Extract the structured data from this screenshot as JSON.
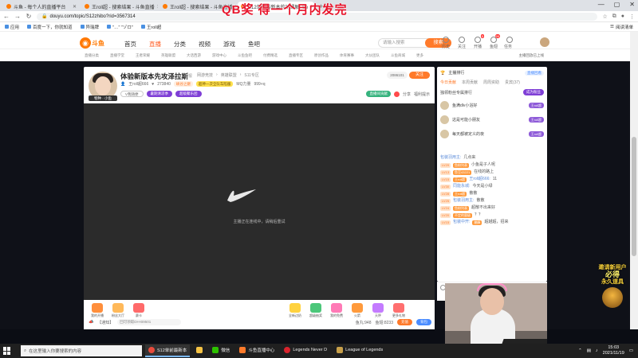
{
  "overlay_caption": "QB奖  得一个月内发完",
  "browser": {
    "tabs": [
      {
        "title": "斗鱼 - 每个人的直播平台",
        "active": false
      },
      {
        "title": "王roll超 - 搜索结果 - 斗鱼直播",
        "active": false
      },
      {
        "title": "王roll超 - 搜索结果 - 斗鱼直播",
        "active": false
      },
      {
        "title": "S12单前最新本的功课解_Se",
        "active": true
      }
    ],
    "new_tab": "+",
    "url": "douyu.com/topic/S12zhibo?rid=3567314",
    "bookmarks": [
      "应用",
      "百度一下，你就知道",
      "异瑞牌",
      "\"…\" \"ゾロ\"",
      "王roll超"
    ],
    "bookmarks_right": "阅读清单"
  },
  "douyu": {
    "logo_text": "斗鱼",
    "nav": [
      "首页",
      "直播",
      "分类",
      "视频",
      "游戏",
      "鱼吧"
    ],
    "active_nav": "直播",
    "search_placeholder": "请输入搜索",
    "search_button": "搜索",
    "header_icons": [
      {
        "label": "历史",
        "badge": ""
      },
      {
        "label": "关注",
        "badge": ""
      },
      {
        "label": "开播",
        "badge": "5"
      },
      {
        "label": "鱼翅",
        "badge": "99"
      },
      {
        "label": "任务中心",
        "badge": ""
      }
    ],
    "categories": [
      "直播分类",
      "直播学堂",
      "王者荣耀",
      "英雄联盟",
      "大话西游",
      "游戏中心",
      "斗鱼鱼吧",
      "付费精选",
      "直播专区",
      "原创作品",
      "体育赛事",
      "大伙团队",
      "斗鱼商城",
      "更多"
    ],
    "categories_right": "主播回放已上线"
  },
  "room": {
    "title": "体验新版本先攻泽拉斯",
    "report": "举报",
    "breadcrumbs": [
      "网游竞技",
      "英雄联盟",
      "S11专区"
    ],
    "level_tag": "物种 · 小鱼",
    "streamer_name": "王roll超666",
    "fans_count": "273840",
    "badge1": "峡谷之巅",
    "badge2": "超神一次全队车陷服",
    "mq": "MQ力量",
    "hot_label": "999+q",
    "tags": [
      "V我随便",
      "暑期清凉季",
      "超级聚乐团"
    ],
    "hot_count": "2086101",
    "follow": "关注",
    "actions": [
      "直播间贡献",
      "分享",
      "福利提示"
    ],
    "player_message": "主播正在连线中，请稍后重试"
  },
  "giftbar": {
    "gifts_left": [
      "我的开播",
      "粉丝大厅",
      "赛卡"
    ],
    "gifts_right": [
      "全新边奶",
      "超级抽奖",
      "我的免费",
      "火箭",
      "天秤",
      "更多礼物"
    ],
    "notice_label": "【通知】",
    "notice_text": "回可领取DH-B9501",
    "fish_balls": "鱼丸:948",
    "fish_fins": "鱼翅:8233",
    "charge_button": "充值",
    "bag_button": "背包"
  },
  "right_panel": {
    "header": "主播排行",
    "header_tag": "直播回看",
    "tabs": [
      "今日贡献",
      "本周贡献",
      "周周资助",
      "贵宾(37)"
    ],
    "sub_title": "独领粉丝专属排行",
    "sub_button": "成为粉丝",
    "ranks": [
      {
        "name": "鱼满dlv小浴好",
        "badge": "王roll超"
      },
      {
        "name": "这是可能小朋友",
        "badge": "王roll超"
      },
      {
        "name": "每天都被定义的夜",
        "badge": "王roll超"
      }
    ],
    "chat": [
      {
        "lv": "",
        "name": "包装羽用主:",
        "text": "几点来",
        "fans": ""
      },
      {
        "lv": "LV29",
        "name": "",
        "text": "小鱼是子人呢",
        "fans": "鱼粉列表"
      },
      {
        "lv": "LV13",
        "name": "",
        "text": "在线的路上",
        "fans": "鱼豆43221"
      },
      {
        "lv": "LV15",
        "name": "王roll超666:",
        "text": "11",
        "fans": "王roll超"
      },
      {
        "lv": "LV30",
        "name": "同能永城:",
        "text": "今天是小绿",
        "fans": ""
      },
      {
        "lv": "LV28",
        "name": "",
        "text": "散散",
        "fans": "王roll超"
      },
      {
        "lv": "LV25",
        "name": "包装羽用主:",
        "text": "散散",
        "fans": ""
      },
      {
        "lv": "LV24",
        "name": "",
        "text": "超散不出来好",
        "fans": "鱼粉列表"
      },
      {
        "lv": "LV20",
        "name": "",
        "text": "？？",
        "fans": "不定的量级"
      },
      {
        "lv": "LV15",
        "name": "包装中开:",
        "text": "超越超，招来",
        "fans": "巅峰"
      }
    ]
  },
  "ad": {
    "line1": "邀请新用户",
    "line2": "必得",
    "line3": "永久道具"
  },
  "taskbar": {
    "search_placeholder": "在这里输入你要搜索的内容",
    "apps": [
      {
        "label": "S12单前最新本",
        "active": true
      },
      {
        "label": "",
        "active": false
      },
      {
        "label": "微信",
        "active": false
      },
      {
        "label": "斗鱼直播中心",
        "active": false
      },
      {
        "label": "Legends Never D",
        "active": false
      },
      {
        "label": "League of Legends",
        "active": false
      }
    ],
    "time": "15:03",
    "date": "2021/11/19"
  }
}
